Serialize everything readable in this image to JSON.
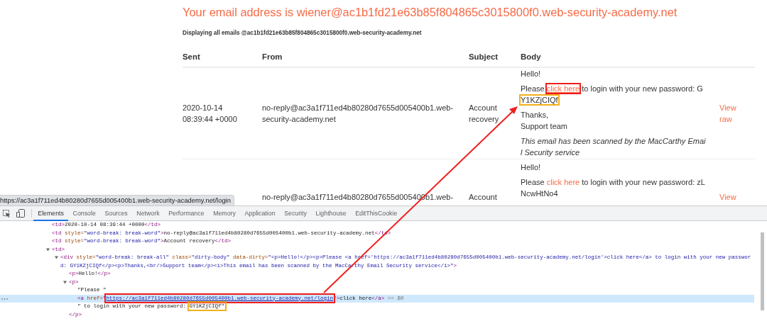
{
  "page": {
    "heading": "Your email address is wiener@ac1b1fd21e63b85f804865c3015800f0.web-security-academy.net",
    "subheading": "Displaying all emails @ac1b1fd21e63b85f804865c3015800f0.web-security-academy.net",
    "columns": [
      "Sent",
      "From",
      "Subject",
      "Body"
    ],
    "emails": [
      {
        "sent": "2020-10-14 08:39:44 +0000",
        "from": "no-reply@ac3a1f711ed4b80280d7655d005400b1.web-security-academy.net",
        "subject": "Account recovery",
        "body": {
          "greeting": "Hello!",
          "message": {
            "before": "Please ",
            "link": "click here",
            "hovered": true,
            "link_boxed": true,
            "after": " to login with your new password: ",
            "password": [
              "G",
              "Y1KZjCIQf"
            ],
            "password_boxed": true
          },
          "sign_off": [
            "Thanks,",
            "Support team"
          ],
          "notice": "This email has been scanned by the MacCarthy Email Security service"
        },
        "action": "View raw"
      },
      {
        "from": "no-reply@ac3a1f711ed4b80280d7655d005400b1.web-",
        "subject": "Account",
        "body": {
          "greeting": "Hello!",
          "message": {
            "before": "Please ",
            "link": "click here",
            "hovered": false,
            "link_boxed": false,
            "after": " to login with your new password: ",
            "password": [
              "zL",
              "NcwHtNo4"
            ],
            "password_boxed": false
          }
        },
        "action": "View"
      }
    ]
  },
  "status_url": "https://ac3a1f711ed4b80280d7655d005400b1.web-security-academy.net/login",
  "devtools": {
    "tabs": [
      {
        "label": "Elements",
        "selected": true
      },
      {
        "label": "Console",
        "selected": false
      },
      {
        "label": "Sources",
        "selected": false
      },
      {
        "label": "Network",
        "selected": false
      },
      {
        "label": "Performance",
        "selected": false
      },
      {
        "label": "Memory",
        "selected": false
      },
      {
        "label": "Application",
        "selected": false
      },
      {
        "label": "Security",
        "selected": false
      },
      {
        "label": "Lighthouse",
        "selected": false
      },
      {
        "label": "EditThisCookie",
        "selected": false
      }
    ],
    "tree": [
      {
        "selected": false,
        "tokens": [
          {
            "kind": "tag",
            "text": "<td>"
          },
          {
            "kind": "text",
            "text": "2020-10-14 08:39:44 +0000"
          },
          {
            "kind": "tag",
            "text": "</td>"
          }
        ]
      },
      {
        "selected": false,
        "tokens": [
          {
            "kind": "tag",
            "text": "<td "
          },
          {
            "kind": "attr",
            "text": "style="
          },
          {
            "kind": "value",
            "text": "\"word-break: break-word\""
          },
          {
            "kind": "tag",
            "text": ">"
          },
          {
            "kind": "text",
            "text": "no-reply@ac3a1f711ed4b80280d7655d005400b1.web-security-academy.net"
          },
          {
            "kind": "tag",
            "text": "</td>"
          }
        ]
      },
      {
        "selected": false,
        "tokens": [
          {
            "kind": "tag",
            "text": "<td "
          },
          {
            "kind": "attr",
            "text": "style="
          },
          {
            "kind": "value",
            "text": "\"word-break: break-word\""
          },
          {
            "kind": "tag",
            "text": ">"
          },
          {
            "kind": "text",
            "text": "Account recovery"
          },
          {
            "kind": "tag",
            "text": "</td>"
          }
        ]
      },
      {
        "selected": false,
        "expanded": true,
        "tokens": [
          {
            "kind": "tag",
            "text": "<td>"
          }
        ],
        "children": [
          {
            "selected": false,
            "expanded": true,
            "tokens": [
              {
                "kind": "tag",
                "text": "<div "
              },
              {
                "kind": "attr",
                "text": "style="
              },
              {
                "kind": "value",
                "text": "\"word-break: break-all\" "
              },
              {
                "kind": "attr",
                "text": "class="
              },
              {
                "kind": "value",
                "text": "\"dirty-body\" "
              },
              {
                "kind": "attr",
                "text": "data-dirty="
              },
              {
                "kind": "value",
                "text": "\"<p>Hello!</p><p>Please <a href='https://ac3a1f711ed4b80280d7655d005400b1.web-security-academy.net/login'>click here</a> to login with your new password: GY1KZjCIQf</p><p>Thanks,<br/>Support team</p><i>This email has been scanned by the MacCarthy Email Security service</i>\""
              },
              {
                "kind": "tag",
                "text": ">"
              }
            ],
            "children": [
              {
                "selected": false,
                "tokens": [
                  {
                    "kind": "tag",
                    "text": "<p>"
                  },
                  {
                    "kind": "text",
                    "text": "Hello!"
                  },
                  {
                    "kind": "tag",
                    "text": "</p>"
                  }
                ]
              },
              {
                "selected": false,
                "expanded": true,
                "tokens": [
                  {
                    "kind": "tag",
                    "text": "<p>"
                  }
                ],
                "close": [
                  {
                    "kind": "tag",
                    "text": "</p>"
                  }
                ],
                "children": [
                  {
                    "selected": false,
                    "tokens": [
                      {
                        "kind": "text",
                        "text": "\"Please \""
                      }
                    ]
                  },
                  {
                    "selected": true,
                    "tokens": [
                      {
                        "kind": "tag",
                        "text": "<a "
                      },
                      {
                        "kind": "attr",
                        "text": "href="
                      },
                      {
                        "kind": "value",
                        "text": "\""
                      },
                      {
                        "kind": "link",
                        "text": "https://ac3a1f711ed4b80280d7655d005400b1.web-security-academy.net/login",
                        "boxed": true
                      },
                      {
                        "kind": "value",
                        "text": "\""
                      },
                      {
                        "kind": "tag",
                        "text": ">"
                      },
                      {
                        "kind": "text",
                        "text": "click here"
                      },
                      {
                        "kind": "tag",
                        "text": "</a>"
                      },
                      {
                        "kind": "note",
                        "text": " == $0"
                      }
                    ]
                  },
                  {
                    "selected": false,
                    "tokens": [
                      {
                        "kind": "text",
                        "text": "\" to login with your new password: "
                      },
                      {
                        "kind": "text",
                        "text": "GY1KZjCIQf\"",
                        "boxed": true
                      }
                    ]
                  }
                ]
              }
            ]
          }
        ]
      }
    ]
  }
}
